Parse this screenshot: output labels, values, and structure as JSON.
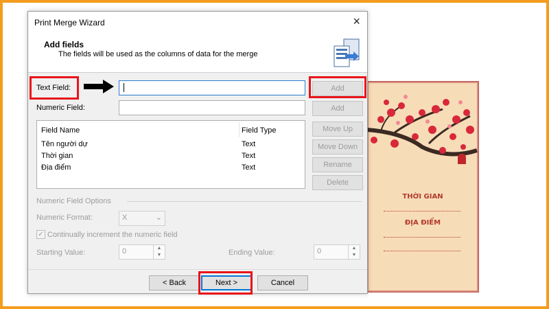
{
  "dialog": {
    "title": "Print Merge Wizard",
    "close_icon": "×",
    "header_title": "Add fields",
    "header_subtitle": "The fields will be used as the columns of data for the merge"
  },
  "fields": {
    "text_field_label": "Text Field:",
    "text_field_value": "",
    "numeric_field_label": "Numeric Field:",
    "numeric_field_value": ""
  },
  "buttons": {
    "add": "Add",
    "add_numeric": "Add",
    "move_up": "Move Up",
    "move_down": "Move Down",
    "rename": "Rename",
    "delete": "Delete",
    "back": "< Back",
    "next": "Next >",
    "cancel": "Cancel"
  },
  "table": {
    "columns": [
      "Field Name",
      "Field Type"
    ],
    "rows": [
      {
        "name": "Tên người dự",
        "type": "Text"
      },
      {
        "name": "Thời gian",
        "type": "Text"
      },
      {
        "name": "Địa điểm",
        "type": "Text"
      }
    ]
  },
  "numeric_options": {
    "group_label": "Numeric Field Options",
    "format_label": "Numeric Format:",
    "format_value": "X",
    "increment_label": "Continually increment the numeric field",
    "increment_checked": true,
    "start_label": "Starting Value:",
    "start_value": "0",
    "end_label": "Ending Value:",
    "end_value": "0"
  },
  "card": {
    "line1": "THỜI GIAN",
    "line2": "ĐỊA ĐIỂM"
  },
  "colors": {
    "frame": "#f39c1e",
    "highlight": "#e8141a",
    "focus": "#2a7bd0"
  },
  "icons": [
    "close-icon",
    "wizard-icon",
    "arrow-right-icon",
    "checkmark-icon",
    "chevron-down-icon",
    "spin-up-icon",
    "spin-down-icon"
  ]
}
